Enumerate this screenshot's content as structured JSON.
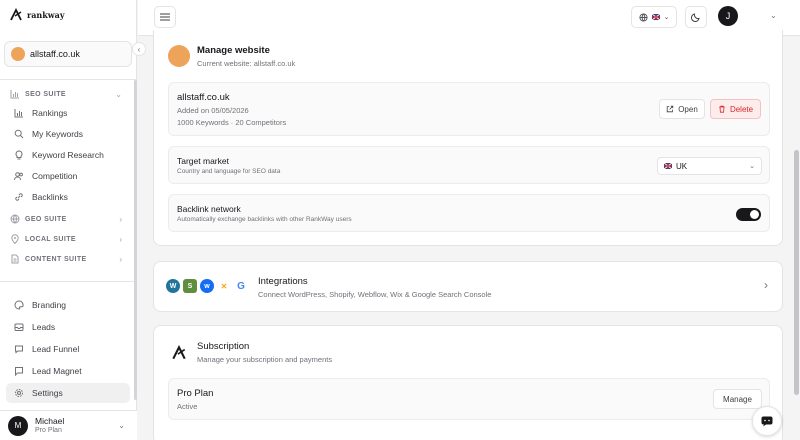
{
  "app": {
    "brand": "rankway"
  },
  "sidebar": {
    "current_site": "allstaff.co.uk",
    "seo_suite": {
      "label": "SEO SUITE",
      "items": [
        {
          "label": "Rankings",
          "icon": "bar-chart-icon"
        },
        {
          "label": "My Keywords",
          "icon": "search-icon"
        },
        {
          "label": "Keyword Research",
          "icon": "lightbulb-icon"
        },
        {
          "label": "Competition",
          "icon": "users-icon"
        },
        {
          "label": "Backlinks",
          "icon": "link-icon"
        }
      ]
    },
    "sections": [
      {
        "label": "GEO SUITE",
        "icon": "globe-icon"
      },
      {
        "label": "LOCAL SUITE",
        "icon": "map-pin-icon"
      },
      {
        "label": "CONTENT SUITE",
        "icon": "document-icon"
      }
    ],
    "bottom_items": [
      {
        "label": "Branding",
        "icon": "palette-icon"
      },
      {
        "label": "Leads",
        "icon": "inbox-icon"
      },
      {
        "label": "Lead Funnel",
        "icon": "chat-icon"
      },
      {
        "label": "Lead Magnet",
        "icon": "message-icon"
      },
      {
        "label": "Settings",
        "icon": "gear-icon",
        "active": true
      }
    ],
    "user": {
      "name": "Michael",
      "plan": "Pro Plan",
      "initial": "M"
    }
  },
  "topbar": {
    "avatar_initial": "J"
  },
  "manage": {
    "title": "Manage website",
    "subtitle": "Current website: allstaff.co.uk",
    "site": {
      "domain": "allstaff.co.uk",
      "added": "Added on 05/05/2026",
      "stats": "1000 Keywords · 20 Competitors",
      "open_label": "Open",
      "delete_label": "Delete"
    },
    "target_market": {
      "title": "Target market",
      "desc": "Country and language for SEO data",
      "value": "UK"
    },
    "backlink_network": {
      "title": "Backlink network",
      "desc": "Automatically exchange backlinks with other RankWay users",
      "enabled": true
    }
  },
  "integrations": {
    "title": "Integrations",
    "desc": "Connect WordPress, Shopify, Webflow, Wix & Google Search Console",
    "icons": [
      "wordpress-icon",
      "shopify-icon",
      "webflow-icon",
      "wix-icon",
      "google-icon"
    ]
  },
  "subscription": {
    "title": "Subscription",
    "desc": "Manage your subscription and payments",
    "plan": "Pro Plan",
    "status": "Active",
    "manage_label": "Manage"
  },
  "colors": {
    "accent_site": "#eea35a",
    "danger": "#dc2626",
    "dark": "#18181b"
  }
}
